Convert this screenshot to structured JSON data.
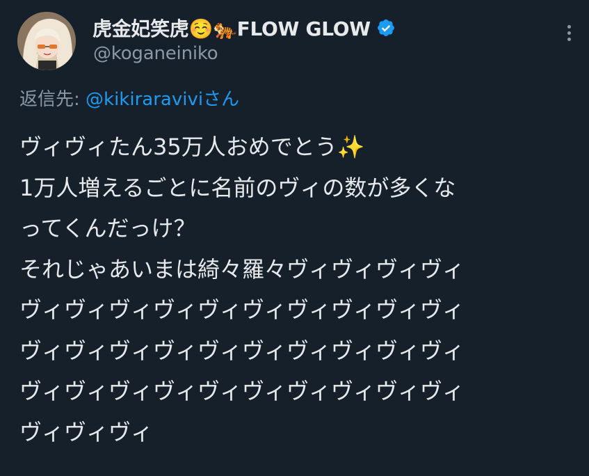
{
  "tweet": {
    "display_name": "虎金妃笑虎☺️🐅FLOW GLOW",
    "handle": "@koganeiniko",
    "reply_label": "返信先: ",
    "reply_user": "@kikiraravivi",
    "reply_suffix": "さん",
    "text_lines": [
      "ヴィヴィたん35万人おめでとう✨",
      "1万人増えるごとに名前のヴィの数が多くな",
      "ってくんだっけ？",
      "それじゃあいまは綺々羅々ヴィヴィヴィヴィ",
      "ヴィヴィヴィヴィヴィヴィヴィヴィヴィヴィ",
      "ヴィヴィヴィヴィヴィヴィヴィヴィヴィヴィ",
      "ヴィヴィヴィヴィヴィヴィヴィヴィヴィヴィ",
      "ヴィヴィヴィ"
    ]
  },
  "icons": {
    "avatar": "avatar-image",
    "verified": "verified-badge-icon",
    "more": "more-options-icon"
  },
  "colors": {
    "background": "#15202b",
    "text": "#e7e9ea",
    "secondary": "#8b98a5",
    "link": "#1d9bf0"
  }
}
